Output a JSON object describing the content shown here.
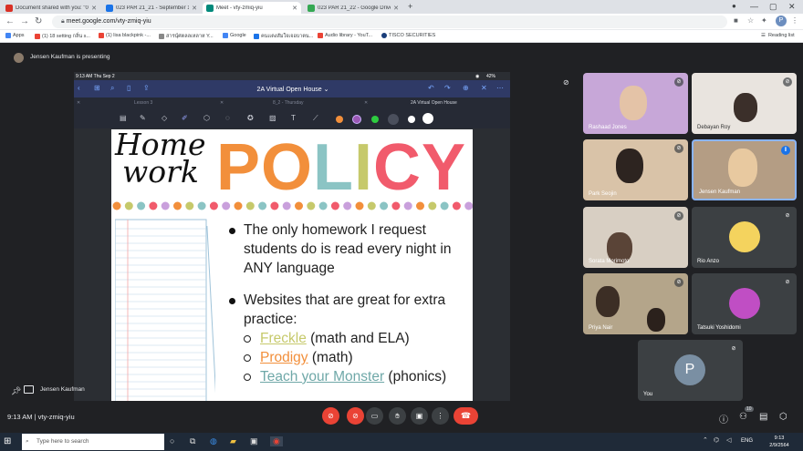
{
  "browser": {
    "tabs": [
      {
        "title": "Document shared with you: \"023",
        "color": "#d93025"
      },
      {
        "title": "023 PAR 21_21 - September 1 - V",
        "color": "#1a73e8"
      },
      {
        "title": "Meet - vty-zmiq-yiu",
        "color": "#00897b"
      },
      {
        "title": "023 PAR 21_22 - Google Drive",
        "color": "#34a853"
      }
    ],
    "url": "meet.google.com/vty-zmiq-yiu",
    "bookmarks": [
      {
        "label": "Apps",
        "color": "#4285f4"
      },
      {
        "label": "(1) 18 setting กลิ่น s...",
        "color": "#ea4335"
      },
      {
        "label": "(1) lisa blackpink -...",
        "color": "#ea4335"
      },
      {
        "label": "สารนุ์ศตลลเหลาห Y...",
        "color": "#888888"
      },
      {
        "label": "Google",
        "color": "#4285f4"
      },
      {
        "label": "คนเเตงสัมใจเจอบาตน...",
        "color": "#1a73e8"
      },
      {
        "label": "Audio library - YouT...",
        "color": "#ea4335"
      },
      {
        "label": "TISCO SECURITIES",
        "color": "#1a3d7a"
      }
    ],
    "reading_list": "Reading list",
    "avatar_letter": "P"
  },
  "meet": {
    "presenting": "Jensen Kaufman is presenting",
    "presenter_name": "Jensen Kaufman",
    "time_code": "9:13 AM  |  vty-zmiq-yiu",
    "participant_count": "10",
    "participants": [
      {
        "name": "Rashaad Jones",
        "color": "#c7a7d8"
      },
      {
        "name": "Debayan Roy",
        "color": "#e9e4df"
      },
      {
        "name": "Park Seojin",
        "color": "#d9c3a8"
      },
      {
        "name": "Jensen Kaufman",
        "color": "#b49d84"
      },
      {
        "name": "Sorata Morimoto",
        "color": "#d8cfc3"
      },
      {
        "name": "Rio Anzo",
        "color": "#3c4043"
      },
      {
        "name": "Priya Nair",
        "color": "#b4a58a"
      },
      {
        "name": "Tatsuki Yoshidomi",
        "color": "#3c4043"
      },
      {
        "name": "You",
        "color": "#3c4043"
      }
    ],
    "you_letter": "P"
  },
  "ipad": {
    "status_time": "9:13 AM   Thu Sep 2",
    "battery": "42%",
    "doc_title": "2A Virtual Open House",
    "tabs": [
      "Lesson 3",
      "8_2 - Thursday",
      "2A Virtual Open House"
    ]
  },
  "slide": {
    "homework_line1": "Home",
    "homework_line2": "work",
    "policy_letters": [
      "P",
      "O",
      "L",
      "I",
      "C",
      "Y"
    ],
    "bullet1": "The only homework I request students do is read every night in ANY language",
    "bullet2": "Websites that are great for extra practice:",
    "sites": [
      {
        "link": "Freckle",
        "rest": " (math and ELA)",
        "color": "#c6c96b"
      },
      {
        "link": "Prodigy",
        "rest": " (math)",
        "color": "#f28f3b"
      },
      {
        "link": "Teach your Monster",
        "rest": " (phonics)",
        "color": "#6fa8a8"
      }
    ]
  },
  "taskbar": {
    "search_placeholder": "Type here to search",
    "language": "ENG",
    "clock_time": "9:13",
    "clock_date": "2/9/2564"
  },
  "colors": {
    "policy": [
      "#f28f3b",
      "#f28f3b",
      "#8bc4c4",
      "#c6c96b",
      "#f15b6c",
      "#f15b6c"
    ],
    "bunting": [
      "#f28f3b",
      "#c6c96b",
      "#8bc4c4",
      "#f15b6c",
      "#c9a0dc"
    ]
  }
}
